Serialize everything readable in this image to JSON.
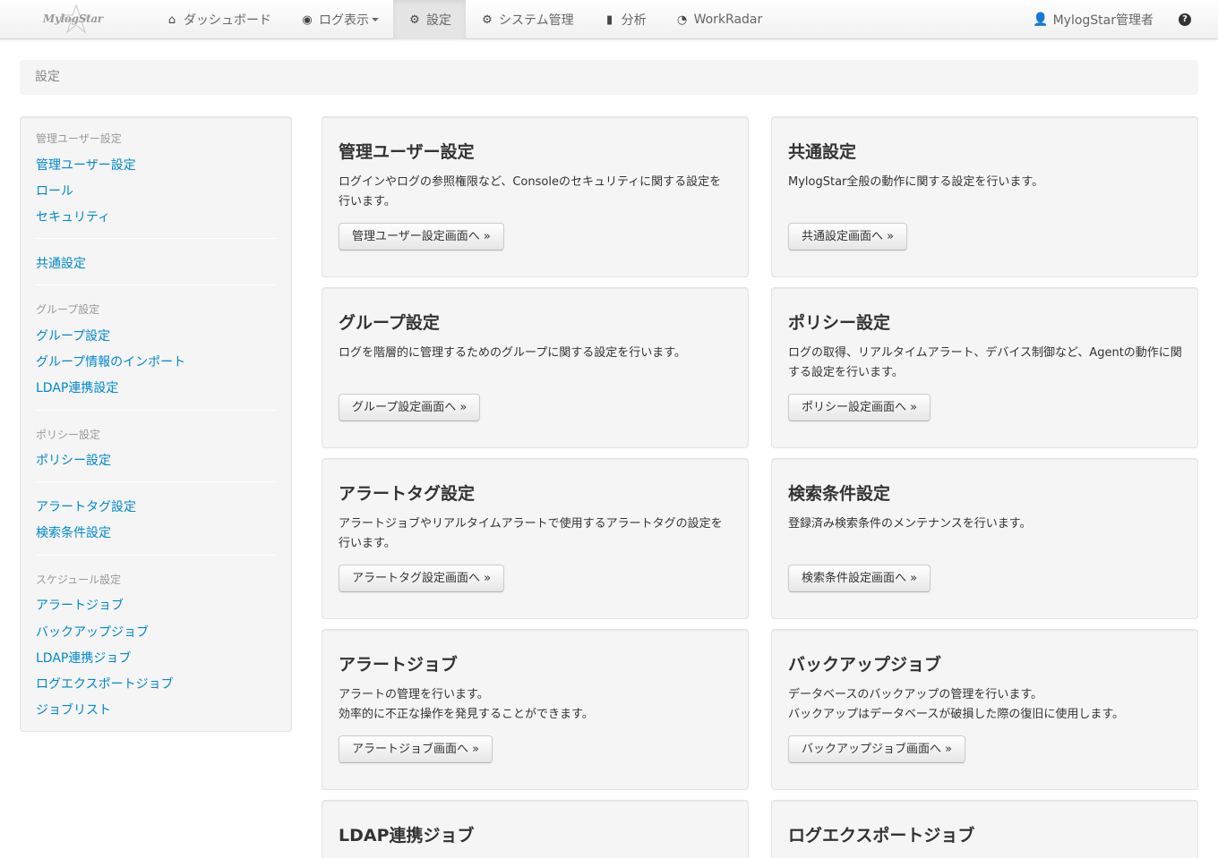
{
  "brand": {
    "logo_text": "MylogStar"
  },
  "nav": {
    "items": [
      {
        "label": "ダッシュボード",
        "icon": "home-icon"
      },
      {
        "label": "ログ表示",
        "icon": "eye-icon"
      },
      {
        "label": "設定",
        "icon": "gear-icon"
      },
      {
        "label": "システム管理",
        "icon": "gear-icon"
      },
      {
        "label": "分析",
        "icon": "book-icon"
      },
      {
        "label": "WorkRadar",
        "icon": "radar-icon"
      }
    ],
    "user": "MylogStar管理者",
    "help_glyph": "?"
  },
  "breadcrumb": {
    "current": "設定"
  },
  "sidebar": {
    "admin_header": "管理ユーザー設定",
    "admin_user": "管理ユーザー設定",
    "role": "ロール",
    "security": "セキュリティ",
    "common": "共通設定",
    "group_header": "グループ設定",
    "group": "グループ設定",
    "group_import": "グループ情報のインポート",
    "ldap": "LDAP連携設定",
    "policy_header": "ポリシー設定",
    "policy": "ポリシー設定",
    "alert_tag": "アラートタグ設定",
    "search_cond": "検索条件設定",
    "schedule_header": "スケジュール設定",
    "alert_job": "アラートジョブ",
    "backup_job": "バックアップジョブ",
    "ldap_job": "LDAP連携ジョブ",
    "log_export_job": "ログエクスポートジョブ",
    "job_list": "ジョブリスト"
  },
  "cards": {
    "admin": {
      "title": "管理ユーザー設定",
      "desc1": "ログインやログの参照権限など、Consoleのセキュリティに関する設定を行います。",
      "button": "管理ユーザー設定画面へ »"
    },
    "common": {
      "title": "共通設定",
      "desc1": "MylogStar全般の動作に関する設定を行います。",
      "button": "共通設定画面へ »"
    },
    "group": {
      "title": "グループ設定",
      "desc1": "ログを階層的に管理するためのグループに関する設定を行います。",
      "button": "グループ設定画面へ »"
    },
    "policy": {
      "title": "ポリシー設定",
      "desc1": "ログの取得、リアルタイムアラート、デバイス制御など、Agentの動作に関する設定を行います。",
      "button": "ポリシー設定画面へ »"
    },
    "alert_tag": {
      "title": "アラートタグ設定",
      "desc1": "アラートジョブやリアルタイムアラートで使用するアラートタグの設定を行います。",
      "button": "アラートタグ設定画面へ »"
    },
    "search": {
      "title": "検索条件設定",
      "desc1": "登録済み検索条件のメンテナンスを行います。",
      "button": "検索条件設定画面へ »"
    },
    "alert_job": {
      "title": "アラートジョブ",
      "desc1": "アラートの管理を行います。",
      "desc2": "効率的に不正な操作を発見することができます。",
      "button": "アラートジョブ画面へ »"
    },
    "backup_job": {
      "title": "バックアップジョブ",
      "desc1": "データベースのバックアップの管理を行います。",
      "desc2": "バックアップはデータベースが破損した際の復旧に使用します。",
      "button": "バックアップジョブ画面へ »"
    },
    "ldap_job": {
      "title": "LDAP連携ジョブ"
    },
    "log_export_job": {
      "title": "ログエクスポートジョブ"
    }
  }
}
